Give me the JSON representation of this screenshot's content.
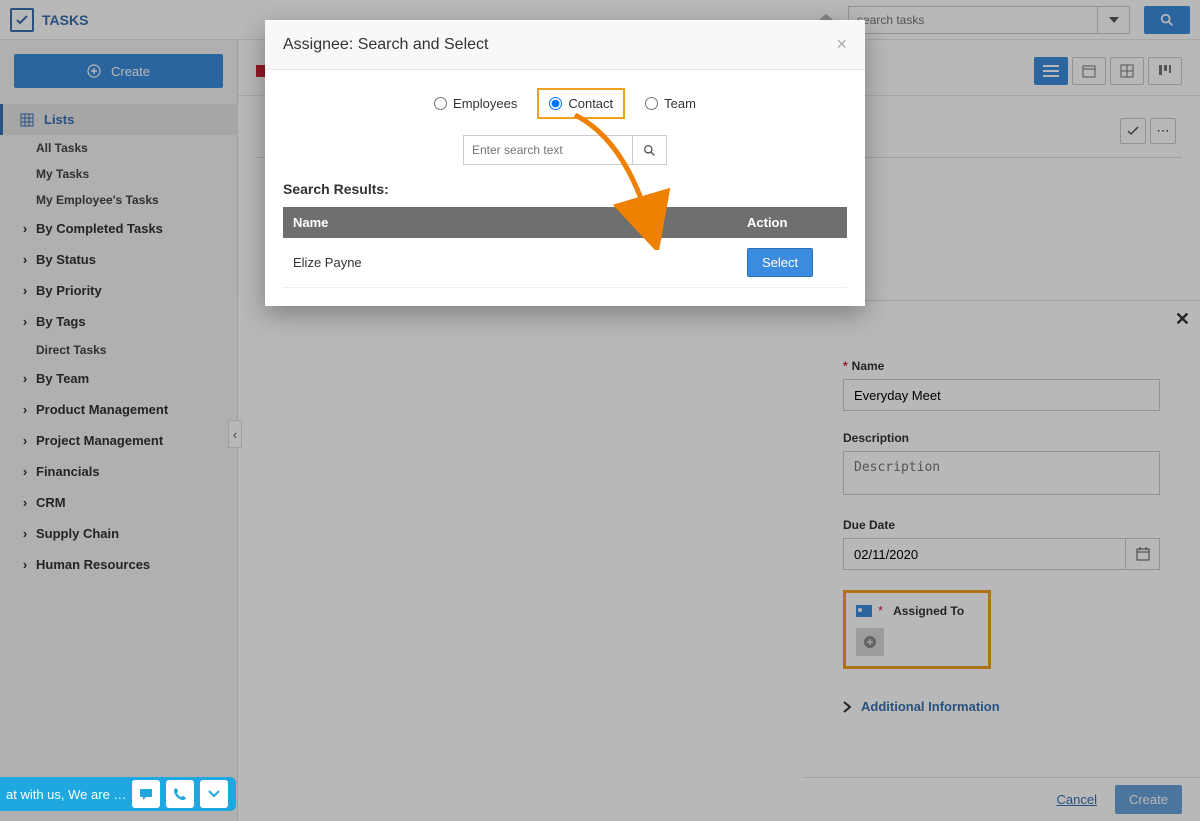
{
  "app": {
    "title": "TASKS"
  },
  "topbar": {
    "search_placeholder": "search tasks"
  },
  "sidebar": {
    "create_label": "Create",
    "lists_label": "Lists",
    "subitems": [
      "All Tasks",
      "My Tasks",
      "My Employee's Tasks"
    ],
    "groups1": [
      "By Completed Tasks",
      "By Status",
      "By Priority",
      "By Tags"
    ],
    "direct_tasks": "Direct Tasks",
    "groups2": [
      "By Team",
      "Product Management",
      "Project Management",
      "Financials",
      "CRM",
      "Supply Chain",
      "Human Resources"
    ]
  },
  "panel": {
    "name_label": "Name",
    "name_value": "Everyday Meet",
    "desc_label": "Description",
    "desc_placeholder": "Description",
    "due_label": "Due Date",
    "due_value": "02/11/2020",
    "assigned_label": "Assigned To",
    "addl_info": "Additional Information",
    "cancel": "Cancel",
    "create": "Create"
  },
  "modal": {
    "title": "Assignee: Search and Select",
    "radios": {
      "employees": "Employees",
      "contact": "Contact",
      "team": "Team"
    },
    "search_placeholder": "Enter search text",
    "results_label": "Search Results:",
    "col_name": "Name",
    "col_action": "Action",
    "row_name": "Elize Payne",
    "select_label": "Select"
  },
  "chat": {
    "text": "at with us, We are …"
  }
}
